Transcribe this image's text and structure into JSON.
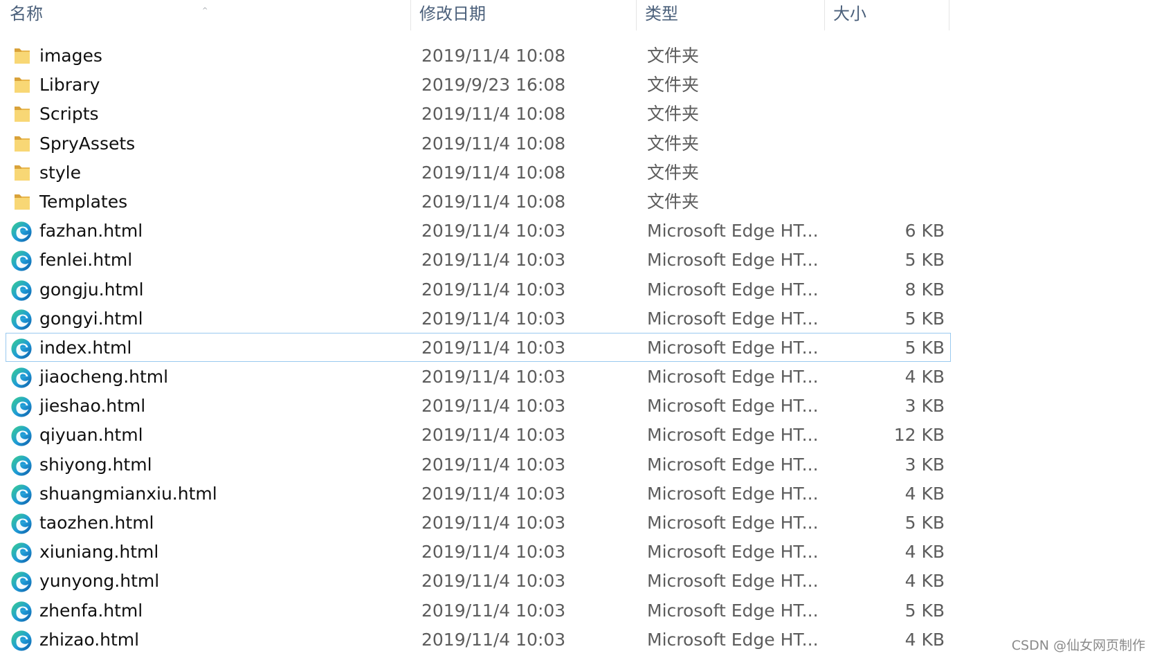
{
  "header": {
    "name": "名称",
    "date": "修改日期",
    "type": "类型",
    "size": "大小",
    "sort_indicator": "^"
  },
  "colors": {
    "header_text": "#4a5f7a",
    "row_text": "#101010",
    "meta_text": "#5c5c5c",
    "focus_border": "#99c9ef",
    "folder_yellow": "#f8d775",
    "edge_blue": "#0c59a4",
    "edge_green": "#3ad08d"
  },
  "rows": [
    {
      "icon": "folder-icon",
      "name": "images",
      "date": "2019/11/4 10:08",
      "type": "文件夹",
      "size": ""
    },
    {
      "icon": "folder-icon",
      "name": "Library",
      "date": "2019/9/23 16:08",
      "type": "文件夹",
      "size": ""
    },
    {
      "icon": "folder-icon",
      "name": "Scripts",
      "date": "2019/11/4 10:08",
      "type": "文件夹",
      "size": ""
    },
    {
      "icon": "folder-icon",
      "name": "SpryAssets",
      "date": "2019/11/4 10:08",
      "type": "文件夹",
      "size": ""
    },
    {
      "icon": "folder-icon",
      "name": "style",
      "date": "2019/11/4 10:08",
      "type": "文件夹",
      "size": ""
    },
    {
      "icon": "folder-icon",
      "name": "Templates",
      "date": "2019/11/4 10:08",
      "type": "文件夹",
      "size": ""
    },
    {
      "icon": "edge-icon",
      "name": "fazhan.html",
      "date": "2019/11/4 10:03",
      "type": "Microsoft Edge HT...",
      "size": "6 KB"
    },
    {
      "icon": "edge-icon",
      "name": "fenlei.html",
      "date": "2019/11/4 10:03",
      "type": "Microsoft Edge HT...",
      "size": "5 KB"
    },
    {
      "icon": "edge-icon",
      "name": "gongju.html",
      "date": "2019/11/4 10:03",
      "type": "Microsoft Edge HT...",
      "size": "8 KB"
    },
    {
      "icon": "edge-icon",
      "name": "gongyi.html",
      "date": "2019/11/4 10:03",
      "type": "Microsoft Edge HT...",
      "size": "5 KB"
    },
    {
      "icon": "edge-icon",
      "name": "index.html",
      "date": "2019/11/4 10:03",
      "type": "Microsoft Edge HT...",
      "size": "5 KB",
      "focused": true
    },
    {
      "icon": "edge-icon",
      "name": "jiaocheng.html",
      "date": "2019/11/4 10:03",
      "type": "Microsoft Edge HT...",
      "size": "4 KB"
    },
    {
      "icon": "edge-icon",
      "name": "jieshao.html",
      "date": "2019/11/4 10:03",
      "type": "Microsoft Edge HT...",
      "size": "3 KB"
    },
    {
      "icon": "edge-icon",
      "name": "qiyuan.html",
      "date": "2019/11/4 10:03",
      "type": "Microsoft Edge HT...",
      "size": "12 KB"
    },
    {
      "icon": "edge-icon",
      "name": "shiyong.html",
      "date": "2019/11/4 10:03",
      "type": "Microsoft Edge HT...",
      "size": "3 KB"
    },
    {
      "icon": "edge-icon",
      "name": "shuangmianxiu.html",
      "date": "2019/11/4 10:03",
      "type": "Microsoft Edge HT...",
      "size": "4 KB"
    },
    {
      "icon": "edge-icon",
      "name": "taozhen.html",
      "date": "2019/11/4 10:03",
      "type": "Microsoft Edge HT...",
      "size": "5 KB"
    },
    {
      "icon": "edge-icon",
      "name": "xiuniang.html",
      "date": "2019/11/4 10:03",
      "type": "Microsoft Edge HT...",
      "size": "4 KB"
    },
    {
      "icon": "edge-icon",
      "name": "yunyong.html",
      "date": "2019/11/4 10:03",
      "type": "Microsoft Edge HT...",
      "size": "4 KB"
    },
    {
      "icon": "edge-icon",
      "name": "zhenfa.html",
      "date": "2019/11/4 10:03",
      "type": "Microsoft Edge HT...",
      "size": "5 KB"
    },
    {
      "icon": "edge-icon",
      "name": "zhizao.html",
      "date": "2019/11/4 10:03",
      "type": "Microsoft Edge HT...",
      "size": "4 KB"
    }
  ],
  "watermark": "CSDN @仙女网页制作"
}
